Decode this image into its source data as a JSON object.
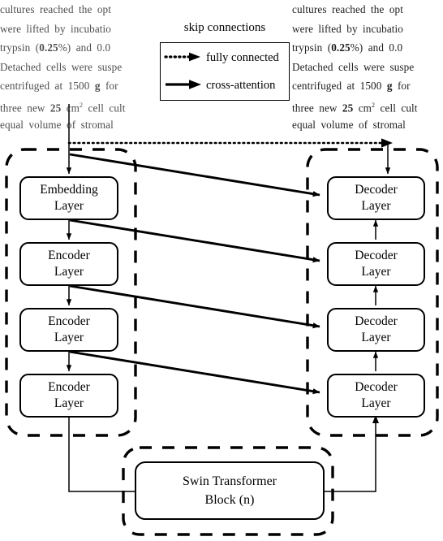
{
  "background_text": {
    "left_column": [
      "cultures reached the opt",
      "were lifted by incubatio",
      "trypsin (0.25%) and 0.0",
      "Detached cells were suspe",
      "centrifuged at 1500 g for",
      "three new 25 cm2 cell cult",
      "equal volume of stromal"
    ],
    "right_column": [
      "cultures reached the opt",
      "were lifted by incubatio",
      "trypsin (0.25%) and 0.0",
      "Detached cells were suspe",
      "centrifuged at 1500 g for",
      "three new 25 cm2 cell cult",
      "equal volume of stromal"
    ]
  },
  "legend": {
    "title": "skip connections",
    "entries": [
      {
        "style": "dotted-arrow",
        "label": "fully connected"
      },
      {
        "style": "solid-arrow",
        "label": "cross-attention"
      }
    ]
  },
  "diagram": {
    "encoder_stack": [
      {
        "id": "embedding-layer",
        "line1": "Embedding",
        "line2": "Layer"
      },
      {
        "id": "encoder-layer-1",
        "line1": "Encoder",
        "line2": "Layer"
      },
      {
        "id": "encoder-layer-2",
        "line1": "Encoder",
        "line2": "Layer"
      },
      {
        "id": "encoder-layer-3",
        "line1": "Encoder",
        "line2": "Layer"
      }
    ],
    "decoder_stack": [
      {
        "id": "decoder-layer-1",
        "line1": "Decoder",
        "line2": "Layer"
      },
      {
        "id": "decoder-layer-2",
        "line1": "Decoder",
        "line2": "Layer"
      },
      {
        "id": "decoder-layer-3",
        "line1": "Decoder",
        "line2": "Layer"
      },
      {
        "id": "decoder-layer-4",
        "line1": "Decoder",
        "line2": "Layer"
      }
    ],
    "bottleneck": {
      "id": "swin-transformer-block",
      "line1": "Swin Transformer",
      "line2": "Block (n)"
    },
    "colors": {
      "stroke": "#000000",
      "fill": "#ffffff"
    }
  }
}
